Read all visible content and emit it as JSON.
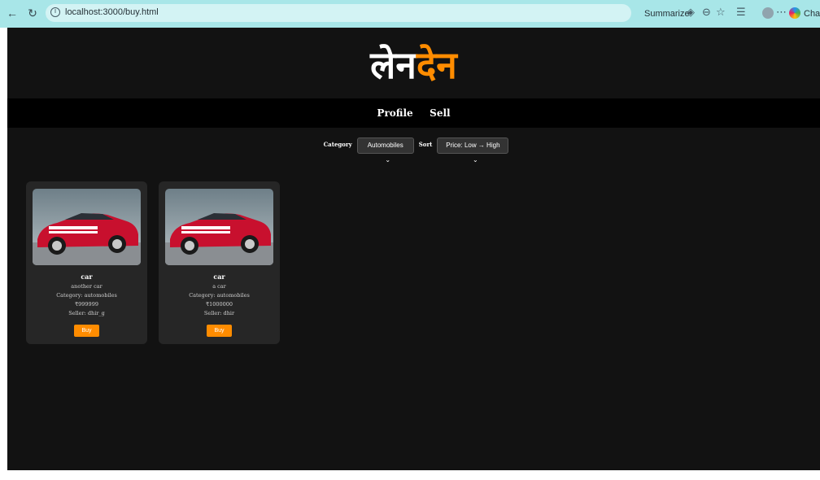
{
  "browser": {
    "url": "localhost:3000/buy.html",
    "summarize_label": "Summarize",
    "chat_label": "Chat",
    "toolbar_icons": [
      "back-icon",
      "reload-icon",
      "info-icon",
      "summarize-icon",
      "zoom-icon",
      "favorite-icon",
      "favorites-icon",
      "profile-icon",
      "more-icon",
      "copilot-icon"
    ]
  },
  "logo": {
    "part1": "लेन",
    "part2": "देन",
    "color1": "#ffffff",
    "color2": "#ff8c00"
  },
  "nav": {
    "profile": "Profile",
    "sell": "Sell"
  },
  "filters": {
    "category_label": "Category",
    "category_value": "Automobiles",
    "sort_label": "Sort",
    "sort_value": "Price: Low → High"
  },
  "products": [
    {
      "title": "car",
      "description": "another car",
      "category": "Category: automobiles",
      "price": "₹999999",
      "seller": "Seller: dhir_g",
      "buy_label": "Buy"
    },
    {
      "title": "car",
      "description": "a car",
      "category": "Category: automobiles",
      "price": "₹1000000",
      "seller": "Seller: dhir",
      "buy_label": "Buy"
    }
  ],
  "colors": {
    "accent": "#ff8c00",
    "background": "#121212",
    "card": "#262626",
    "chrome": "#a8e6e8"
  }
}
